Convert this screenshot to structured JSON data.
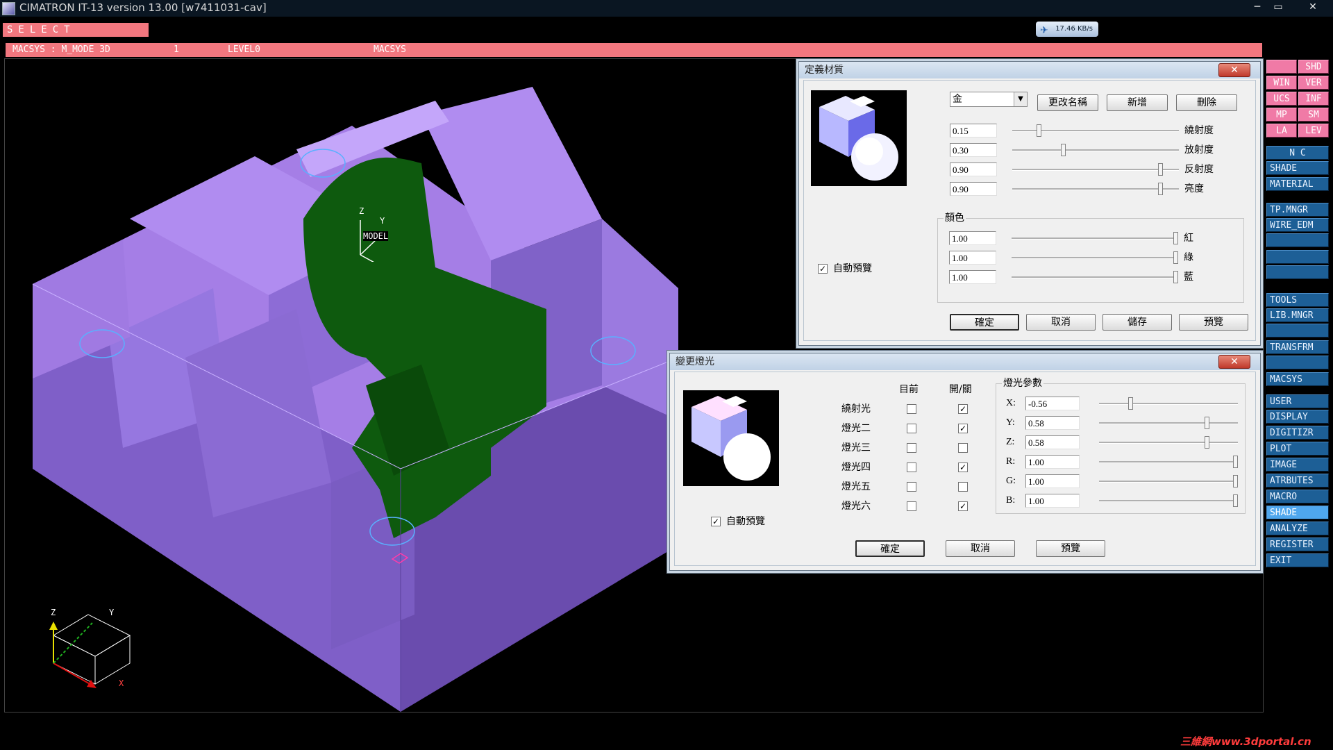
{
  "window": {
    "title": "CIMATRON IT-13 version 13.00 [w7411031-cav]",
    "controls": [
      "─",
      "▭",
      "✕"
    ]
  },
  "select_bar": {
    "label": "SELECT"
  },
  "network_badge": {
    "text": "17.46 KB/s"
  },
  "status_bar": {
    "mode": "MACSYS : M_MODE 3D",
    "number": "1",
    "level": "LEVEL0",
    "system": "MACSYS"
  },
  "viewport": {
    "model_label": "MODEL",
    "axes": {
      "z": "Z",
      "y": "Y",
      "x": "X"
    }
  },
  "side_menu": {
    "top_pairs": [
      [
        "",
        "SHD"
      ],
      [
        "WIN",
        "VER"
      ],
      [
        "UCS",
        "INF"
      ],
      [
        "MP",
        "SM"
      ],
      [
        "LA",
        "LEV"
      ]
    ],
    "items": [
      "N C",
      "SHADE",
      "MATERIAL",
      "TP.MNGR",
      "WIRE_EDM",
      "",
      "",
      "",
      "TOOLS",
      "LIB.MNGR",
      "",
      "TRANSFRM",
      "",
      "MACSYS",
      "USER",
      "DISPLAY",
      "DIGITIZR",
      "PLOT",
      "IMAGE",
      "ATRBUTES",
      "MACRO",
      "SHADE",
      "ANALYZE",
      "REGISTER",
      "EXIT"
    ],
    "active_item": "SHADE"
  },
  "material_dialog": {
    "title": "定義材質",
    "material_select": "金",
    "top_buttons": [
      "更改名稱",
      "新增",
      "刪除"
    ],
    "properties": [
      {
        "value": "0.15",
        "label": "繞射度",
        "pos": 0.15
      },
      {
        "value": "0.30",
        "label": "放射度",
        "pos": 0.3
      },
      {
        "value": "0.90",
        "label": "反射度",
        "pos": 0.9
      },
      {
        "value": "0.90",
        "label": "亮度",
        "pos": 0.9
      }
    ],
    "auto_preview": {
      "label": "自動預覽",
      "checked": "✓"
    },
    "color_group": {
      "title": "顏色",
      "channels": [
        {
          "value": "1.00",
          "label": "紅",
          "pos": 1.0
        },
        {
          "value": "1.00",
          "label": "綠",
          "pos": 1.0
        },
        {
          "value": "1.00",
          "label": "藍",
          "pos": 1.0
        }
      ]
    },
    "bottom_buttons": [
      "確定",
      "取消",
      "儲存",
      "預覽"
    ]
  },
  "light_dialog": {
    "title": "變更燈光",
    "col_current": "目前",
    "col_onoff": "開/關",
    "lights": [
      {
        "name": "繞射光",
        "current": "",
        "on": "✓"
      },
      {
        "name": "燈光二",
        "current": "",
        "on": "✓"
      },
      {
        "name": "燈光三",
        "current": "",
        "on": ""
      },
      {
        "name": "燈光四",
        "current": "",
        "on": "✓"
      },
      {
        "name": "燈光五",
        "current": "",
        "on": ""
      },
      {
        "name": "燈光六",
        "current": "",
        "on": "✓"
      }
    ],
    "params_group": {
      "title": "燈光參數",
      "params": [
        {
          "label": "X:",
          "value": "-0.56",
          "pos": 0.22
        },
        {
          "label": "Y:",
          "value": "0.58",
          "pos": 0.79
        },
        {
          "label": "Z:",
          "value": "0.58",
          "pos": 0.79
        },
        {
          "label": "R:",
          "value": "1.00",
          "pos": 1.0
        },
        {
          "label": "G:",
          "value": "1.00",
          "pos": 1.0
        },
        {
          "label": "B:",
          "value": "1.00",
          "pos": 1.0
        }
      ]
    },
    "auto_preview": {
      "label": "自動預覽",
      "checked": "✓"
    },
    "bottom_buttons": [
      "確定",
      "取消",
      "預覽"
    ]
  },
  "watermark": {
    "text": "三維網www.3dportal.cn"
  },
  "colors": {
    "status_pink": "#f2777f",
    "menu_blue": "#1d5f96",
    "part_purple": "#a57ee6",
    "cavity_green": "#0e5a0e"
  }
}
